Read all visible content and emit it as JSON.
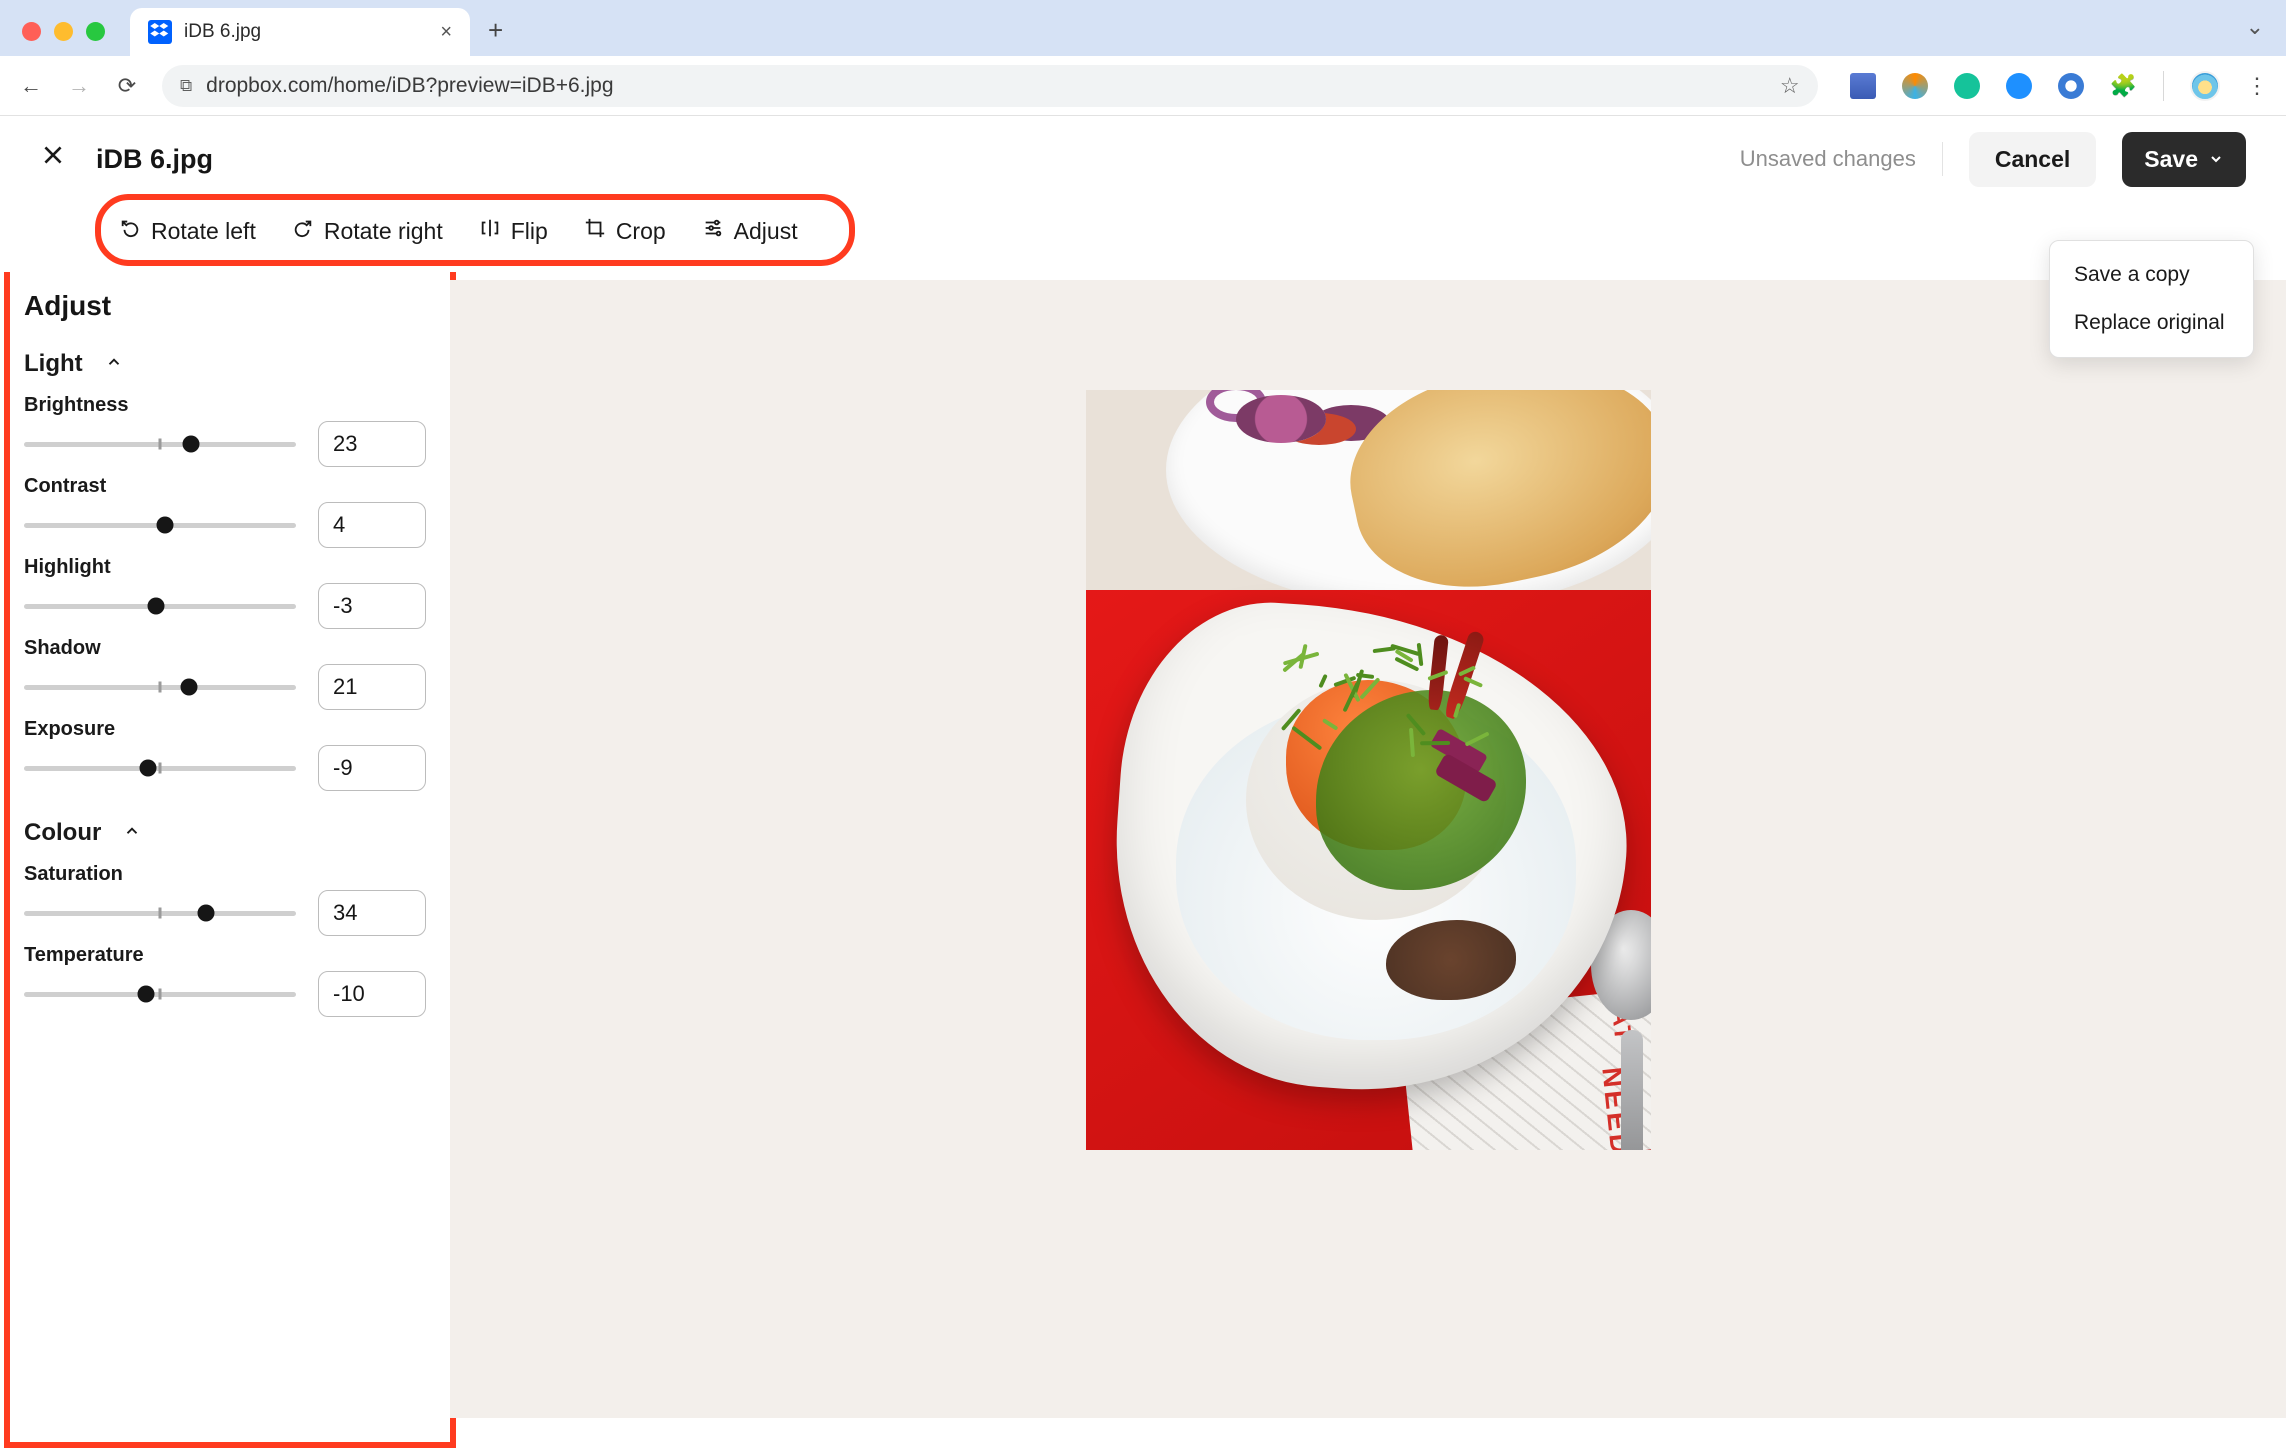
{
  "browser": {
    "tab_title": "iDB 6.jpg",
    "url": "dropbox.com/home/iDB?preview=iDB+6.jpg",
    "extension_icons": [
      "screenshot",
      "circle-orange",
      "grammarly",
      "onenote",
      "dashlane",
      "puzzle"
    ]
  },
  "header": {
    "filename": "iDB 6.jpg",
    "status": "Unsaved changes",
    "cancel": "Cancel",
    "save": "Save",
    "save_menu": {
      "copy": "Save a copy",
      "replace": "Replace original"
    }
  },
  "toolbar": {
    "rotate_left": "Rotate left",
    "rotate_right": "Rotate right",
    "flip": "Flip",
    "crop": "Crop",
    "adjust": "Adjust"
  },
  "panel": {
    "title": "Adjust",
    "sections": {
      "light": {
        "title": "Light",
        "controls": [
          {
            "label": "Brightness",
            "value": 23
          },
          {
            "label": "Contrast",
            "value": 4
          },
          {
            "label": "Highlight",
            "value": -3
          },
          {
            "label": "Shadow",
            "value": 21
          },
          {
            "label": "Exposure",
            "value": -9
          }
        ]
      },
      "colour": {
        "title": "Colour",
        "controls": [
          {
            "label": "Saturation",
            "value": 34
          },
          {
            "label": "Temperature",
            "value": -10
          }
        ]
      }
    }
  },
  "image_mat_text": {
    "a": "NEED",
    "b": "HAT"
  },
  "slider": {
    "min": -100,
    "max": 100
  }
}
